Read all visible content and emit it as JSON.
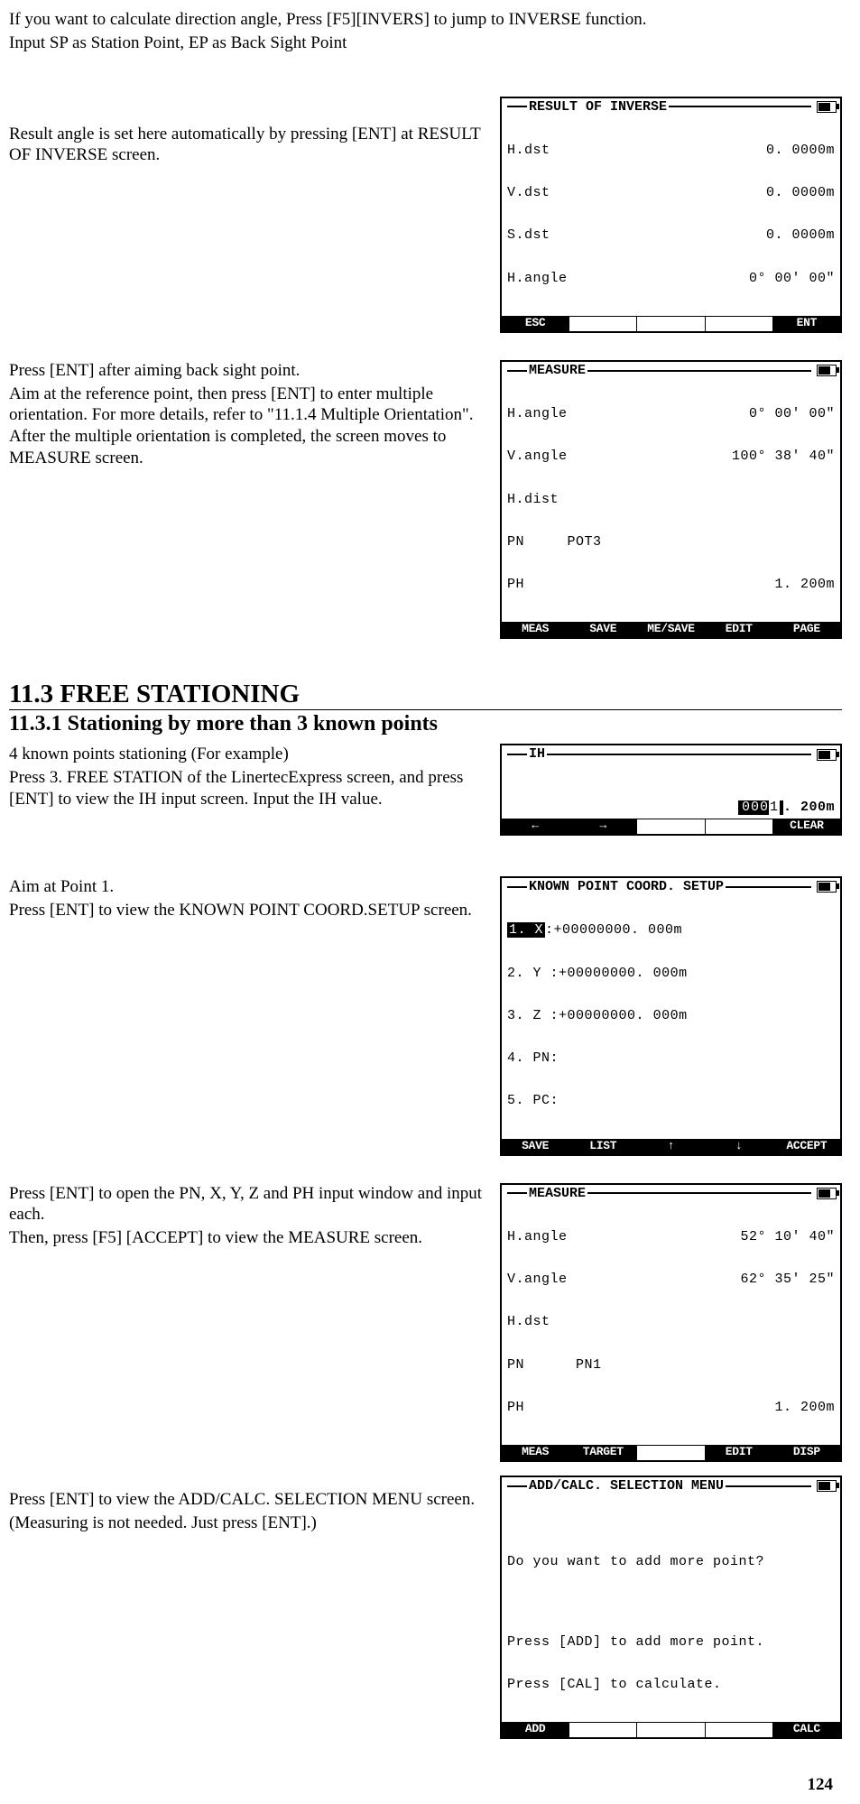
{
  "intro": {
    "p1": "If you want to calculate direction angle, Press [F5][INVERS] to jump to INVERSE function.",
    "p2": "Input SP as Station Point, EP as Back Sight Point"
  },
  "step1": {
    "text1": "Result angle is set here automatically by pressing [ENT] at RESULT OF INVERSE screen.",
    "lcd": {
      "title": "RESULT OF INVERSE",
      "rows": [
        {
          "l": "H.dst",
          "r": "0. 0000m"
        },
        {
          "l": "V.dst",
          "r": "0. 0000m"
        },
        {
          "l": "S.dst",
          "r": "0. 0000m"
        },
        {
          "l": "H.angle",
          "r": "0° 00′ 00″"
        }
      ],
      "sk": [
        "ESC",
        "",
        "",
        "",
        "ENT"
      ]
    }
  },
  "step2": {
    "text1": "Press [ENT] after aiming back sight point.",
    "text2": "Aim at the reference point, then press [ENT] to enter multiple orientation. For more details, refer to \"11.1.4 Multiple Orientation\".  After the multiple orientation is completed, the screen moves to MEASURE screen.",
    "lcd": {
      "title": "MEASURE",
      "rows": [
        {
          "l": "H.angle",
          "r": "0° 00′ 00″"
        },
        {
          "l": "V.angle",
          "r": "100° 38′ 40″"
        },
        {
          "l": "H.dist",
          "r": ""
        },
        {
          "l": "PN     POT3",
          "r": ""
        },
        {
          "l": "PH",
          "r": "1. 200m"
        }
      ],
      "sk": [
        "MEAS",
        "SAVE",
        "ME/SAVE",
        "EDIT",
        "PAGE"
      ]
    }
  },
  "heading": {
    "h1": "11.3 FREE STATIONING",
    "h2": "11.3.1 Stationing by more than 3 known points"
  },
  "step3": {
    "text1": "4 known points stationing (For example)",
    "text2": "Press 3. FREE STATION of the LinertecExpress screen, and press [ENT] to view the IH input screen. Input the IH value.",
    "lcd": {
      "title": "IH",
      "ih_left": "000",
      "ih_cursor": "1",
      "ih_right": ". 200m",
      "sk": [
        "←",
        "→",
        "",
        "",
        "CLEAR"
      ]
    }
  },
  "step4": {
    "text1": "Aim at Point 1.",
    "text2": "Press [ENT] to view the KNOWN POINT COORD.SETUP screen.",
    "lcd": {
      "title": "KNOWN POINT COORD. SETUP",
      "rows": [
        {
          "num": "1. X",
          "sel": true,
          "colon": ":",
          "val": "+00000000. 000m"
        },
        {
          "num": "2. Y",
          "sel": false,
          "colon": ":",
          "val": "+00000000. 000m"
        },
        {
          "num": "3. Z",
          "sel": false,
          "colon": ":",
          "val": "+00000000. 000m"
        },
        {
          "num": "4. PN",
          "sel": false,
          "colon": ":",
          "val": ""
        },
        {
          "num": "5. PC",
          "sel": false,
          "colon": ":",
          "val": ""
        }
      ],
      "sk": [
        "SAVE",
        "LIST",
        "↑",
        "↓",
        "ACCEPT"
      ]
    }
  },
  "step5": {
    "text1": "Press [ENT] to open the PN, X, Y, Z and PH input window and input each.",
    "text2": "Then, press  [F5] [ACCEPT] to view the MEASURE screen.",
    "lcd": {
      "title": "MEASURE",
      "rows": [
        {
          "l": "H.angle",
          "r": "52° 10′ 40″"
        },
        {
          "l": "V.angle",
          "r": "62° 35′ 25″"
        },
        {
          "l": "H.dst",
          "r": ""
        },
        {
          "l": "PN      PN1",
          "r": ""
        },
        {
          "l": "PH",
          "r": "1. 200m"
        }
      ],
      "sk": [
        "MEAS",
        "TARGET",
        "",
        "EDIT",
        "DISP"
      ]
    }
  },
  "step6": {
    "text1": "Press [ENT] to view the ADD/CALC. SELECTION MENU screen.",
    "text2": "(Measuring is not needed. Just press [ENT].)",
    "lcd": {
      "title": "ADD/CALC. SELECTION MENU",
      "line1": "Do you want to add more point?",
      "line2": "Press [ADD] to add more point.",
      "line3": "Press [CAL] to calculate.",
      "sk": [
        "ADD",
        "",
        "",
        "",
        "CALC"
      ]
    }
  },
  "page_number": "124"
}
